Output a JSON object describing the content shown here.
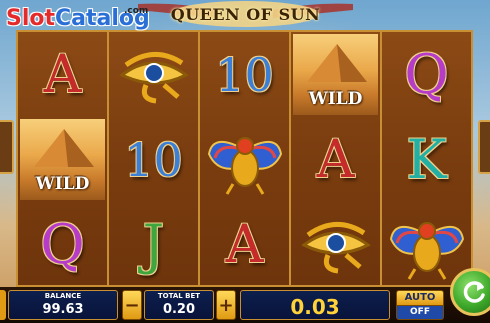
{
  "watermark": {
    "part1": "Slot",
    "part2": "Catalog",
    "suffix": ".com"
  },
  "game": {
    "title": "QUEEN OF SUN"
  },
  "reels": [
    [
      "A",
      "WILD",
      "Q"
    ],
    [
      "horus-eye",
      "10",
      "J"
    ],
    [
      "10",
      "scarab",
      "A"
    ],
    [
      "WILD",
      "A",
      "horus-eye"
    ],
    [
      "Q",
      "K",
      "scarab"
    ]
  ],
  "wild_label": "WILD",
  "controls": {
    "balance_label": "BALANCE",
    "balance_value": "99.63",
    "total_bet_label": "TOTAL BET",
    "total_bet_value": "0.20",
    "minus": "−",
    "plus": "+",
    "win_value": "0.03",
    "auto_label": "AUTO",
    "auto_state": "OFF"
  },
  "colors": {
    "frame_gold": "#c98f33",
    "reel_brown": "#7a3d0f",
    "panel_blue": "#0d1f4d",
    "spin_green": "#3da82a"
  }
}
